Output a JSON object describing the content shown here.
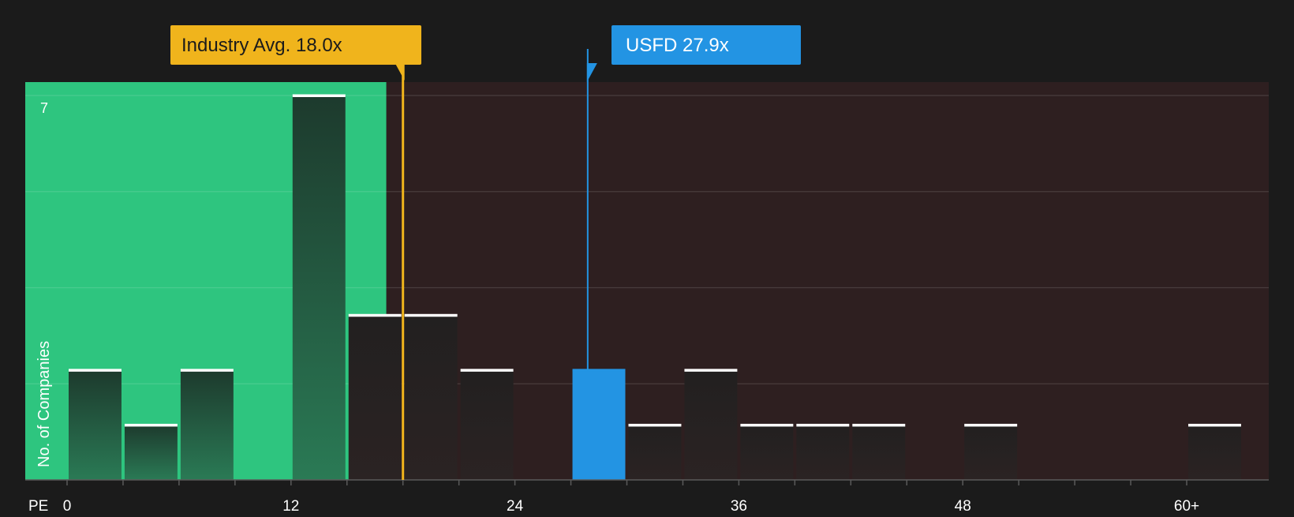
{
  "chart_data": {
    "type": "bar",
    "title": "",
    "xlabel": "PE",
    "ylabel": "No. of Companies",
    "x_tick_labels": [
      "0",
      "12",
      "24",
      "36",
      "48",
      "60+"
    ],
    "x_tick_values": [
      0,
      12,
      24,
      36,
      48,
      60
    ],
    "y_tick_labels": [
      "7"
    ],
    "ylim": [
      0,
      7
    ],
    "bin_width": 3,
    "bins": [
      {
        "start": 0,
        "count": 2
      },
      {
        "start": 3,
        "count": 1
      },
      {
        "start": 6,
        "count": 2
      },
      {
        "start": 9,
        "count": 0
      },
      {
        "start": 12,
        "count": 7
      },
      {
        "start": 15,
        "count": 3
      },
      {
        "start": 18,
        "count": 3
      },
      {
        "start": 21,
        "count": 2
      },
      {
        "start": 24,
        "count": 0
      },
      {
        "start": 27,
        "count": 2,
        "highlight": true
      },
      {
        "start": 30,
        "count": 1
      },
      {
        "start": 33,
        "count": 2
      },
      {
        "start": 36,
        "count": 1
      },
      {
        "start": 39,
        "count": 1
      },
      {
        "start": 42,
        "count": 1
      },
      {
        "start": 45,
        "count": 0
      },
      {
        "start": 48,
        "count": 1
      },
      {
        "start": 51,
        "count": 0
      },
      {
        "start": 54,
        "count": 0
      },
      {
        "start": 57,
        "count": 0
      },
      {
        "start": 60,
        "count": 1
      }
    ],
    "industry_avg": {
      "value": 18.0,
      "label": "Industry Avg. 18.0x"
    },
    "company": {
      "ticker": "USFD",
      "value": 27.9,
      "label": "USFD 27.9x"
    },
    "grid": true,
    "colors": {
      "background": "#1b1b1b",
      "below_avg_region": "#2ec57f",
      "above_avg_region": "#2e1f20",
      "industry_avg": "#f0b41c",
      "company": "#2394e3",
      "bar_cap": "#ffffff"
    }
  }
}
